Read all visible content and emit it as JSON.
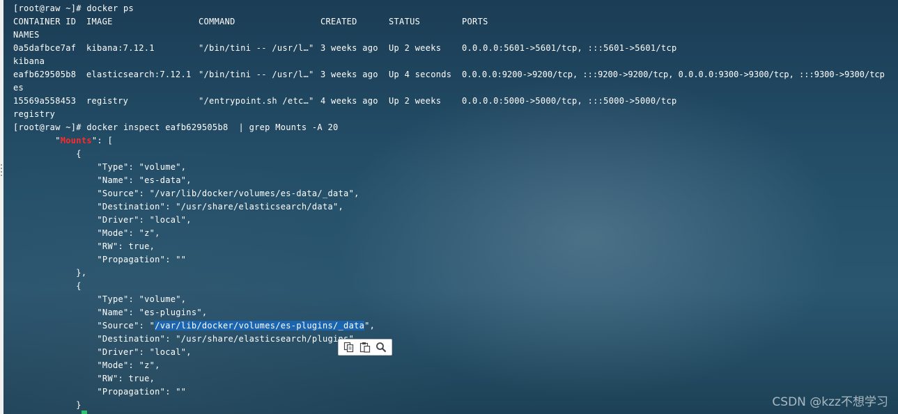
{
  "terminal": {
    "prompt_ps": "[root@raw ~]# docker ps",
    "headers": {
      "container_id": "CONTAINER ID",
      "image": "IMAGE",
      "command": "COMMAND",
      "created": "CREATED",
      "status": "STATUS",
      "ports": "PORTS",
      "names": "NAMES"
    },
    "containers": [
      {
        "id": "0a5dafbce7af",
        "image": "kibana:7.12.1",
        "command": "\"/bin/tini -- /usr/l…\"",
        "created": "3 weeks ago",
        "status": "Up 2 weeks",
        "ports": "0.0.0.0:5601->5601/tcp, :::5601->5601/tcp",
        "name": "kibana"
      },
      {
        "id": "eafb629505b8",
        "image": "elasticsearch:7.12.1",
        "command": "\"/bin/tini -- /usr/l…\"",
        "created": "3 weeks ago",
        "status": "Up 4 seconds",
        "ports": "0.0.0.0:9200->9200/tcp, :::9200->9200/tcp, 0.0.0.0:9300->9300/tcp, :::9300->9300/tcp",
        "name": "es"
      },
      {
        "id": "15569a558453",
        "image": "registry",
        "command": "\"/entrypoint.sh /etc…\"",
        "created": "4 weeks ago",
        "status": "Up 2 weeks",
        "ports": "0.0.0.0:5000->5000/tcp, :::5000->5000/tcp",
        "name": "registry"
      }
    ],
    "prompt_inspect": "[root@raw ~]# docker inspect eafb629505b8  | grep Mounts -A 20",
    "mounts_indent": "        \"",
    "mounts_key": "Mounts",
    "mounts_after": "\": [",
    "inspect_lines": [
      "            {",
      "                \"Type\": \"volume\",",
      "                \"Name\": \"es-data\",",
      "                \"Source\": \"/var/lib/docker/volumes/es-data/_data\",",
      "                \"Destination\": \"/usr/share/elasticsearch/data\",",
      "                \"Driver\": \"local\",",
      "                \"Mode\": \"z\",",
      "                \"RW\": true,",
      "                \"Propagation\": \"\"",
      "            },",
      "            {",
      "                \"Type\": \"volume\",",
      "                \"Name\": \"es-plugins\","
    ],
    "source_prefix": "                \"Source\": \"",
    "source_selected": "/var/lib/docker/volumes/es-plugins/_data",
    "source_suffix": "\",",
    "inspect_lines_after": [
      "                \"Destination\": \"/usr/share/elasticsearch/plugins\",",
      "                \"Driver\": \"local\",",
      "                \"Mode\": \"z\",",
      "                \"RW\": true,",
      "                \"Propagation\": \"\"",
      "            }"
    ]
  },
  "toolbar": {
    "icons": [
      "copy-icon",
      "paste-icon",
      "search-icon"
    ]
  },
  "watermark": "CSDN @kzz不想学习",
  "colors": {
    "highlight": "#ff2a2a",
    "selection": "#1a64b0",
    "text": "#ffffff"
  }
}
